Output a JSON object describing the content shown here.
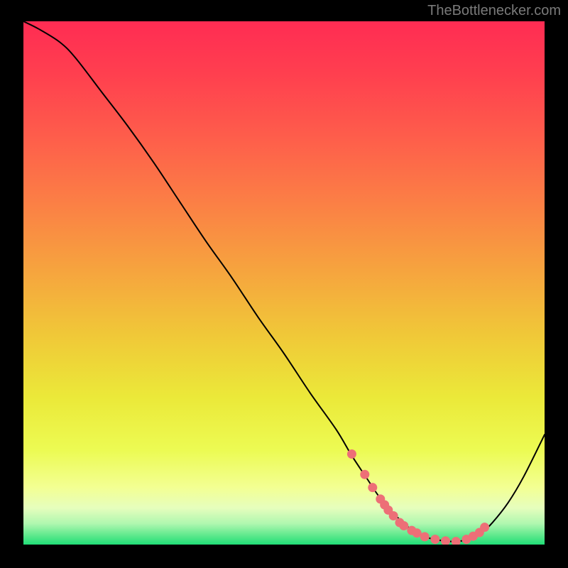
{
  "attribution": "TheBottlenecker.com",
  "chart_data": {
    "type": "line",
    "title": "",
    "xlabel": "",
    "ylabel": "",
    "xlim": [
      0,
      100
    ],
    "ylim": [
      0,
      100
    ],
    "grid": false,
    "legend": false,
    "series": [
      {
        "name": "curve",
        "color": "#000000",
        "x": [
          0,
          3,
          7,
          10,
          15,
          20,
          25,
          30,
          35,
          40,
          45,
          50,
          55,
          60,
          63,
          66,
          68,
          70,
          72,
          74,
          76,
          78,
          80,
          82,
          84,
          86,
          88,
          90,
          93,
          96,
          100
        ],
        "y": [
          100,
          98.5,
          96,
          93,
          86.5,
          80,
          73,
          65.5,
          58,
          51,
          43.5,
          36.5,
          29,
          22,
          17,
          12.5,
          9.5,
          7,
          5,
          3.2,
          2,
          1.2,
          0.8,
          0.6,
          0.7,
          1.2,
          2.3,
          4.2,
          8,
          13,
          21
        ]
      }
    ],
    "markers": [
      {
        "name": "marker-dots",
        "color": "#ED6F77",
        "x": [
          63.0,
          65.5,
          67.0,
          68.5,
          69.3,
          70.0,
          71.0,
          72.2,
          73.0,
          74.5,
          75.5,
          77.0,
          79.0,
          81.0,
          83.0,
          85.0,
          86.3,
          87.5,
          88.5
        ],
        "y": [
          17.3,
          13.4,
          10.9,
          8.7,
          7.6,
          6.6,
          5.5,
          4.2,
          3.6,
          2.7,
          2.2,
          1.5,
          1.0,
          0.7,
          0.6,
          1.0,
          1.6,
          2.3,
          3.3
        ]
      }
    ],
    "background_gradient": [
      {
        "offset": 0.0,
        "color": "#FF2C53"
      },
      {
        "offset": 0.1,
        "color": "#FF3F4F"
      },
      {
        "offset": 0.22,
        "color": "#FE5D4B"
      },
      {
        "offset": 0.35,
        "color": "#FB8045"
      },
      {
        "offset": 0.48,
        "color": "#F6A53E"
      },
      {
        "offset": 0.6,
        "color": "#F0C838"
      },
      {
        "offset": 0.72,
        "color": "#EBE939"
      },
      {
        "offset": 0.82,
        "color": "#ECFB53"
      },
      {
        "offset": 0.89,
        "color": "#F3FF92"
      },
      {
        "offset": 0.93,
        "color": "#E6FEBD"
      },
      {
        "offset": 0.96,
        "color": "#AFF7AF"
      },
      {
        "offset": 0.985,
        "color": "#55E789"
      },
      {
        "offset": 1.0,
        "color": "#21DE78"
      }
    ]
  }
}
